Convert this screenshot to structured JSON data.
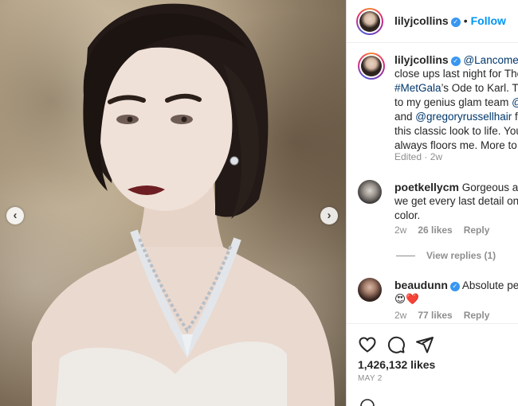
{
  "post": {
    "author": "lilyjcollins",
    "follow_label": "Follow",
    "separator": "•"
  },
  "caption": {
    "lines": [
      [
        "",
        "@Lancomeof"
      ],
      [
        "close ups last night for The",
        ""
      ],
      [
        "",
        "#MetGala",
        "’s Ode to Karl. Th"
      ],
      [
        "to my genius glam team ",
        "@"
      ],
      [
        "and ",
        "@gregoryrussellhair",
        " fo"
      ],
      [
        "this classic look to life. You",
        ""
      ],
      [
        "always floors me. More to c",
        ""
      ]
    ],
    "edited": "Edited · 2w"
  },
  "comments": [
    {
      "username": "poetkellycm",
      "lines": [
        "Gorgeous and",
        "we get every last detail on",
        "color."
      ],
      "time": "2w",
      "likes": "26 likes",
      "reply": "Reply"
    },
    {
      "username": "beaudunn",
      "lines": [
        "Absolute perf",
        "😍❤️"
      ],
      "time": "2w",
      "likes": "77 likes",
      "reply": "Reply"
    }
  ],
  "view_replies": "View replies (1)",
  "likes_count": "1,426,132 likes",
  "post_date": "MAY 2",
  "icons": {
    "like": "heart-icon",
    "comment": "comment-icon",
    "share": "share-icon",
    "prev": "chevron-left-icon",
    "next": "chevron-right-icon",
    "verified": "verified-badge-icon"
  },
  "colors": {
    "accent": "#0095f6",
    "mention": "#00376b",
    "muted": "#8e8e8e",
    "verified": "#3897f0"
  }
}
